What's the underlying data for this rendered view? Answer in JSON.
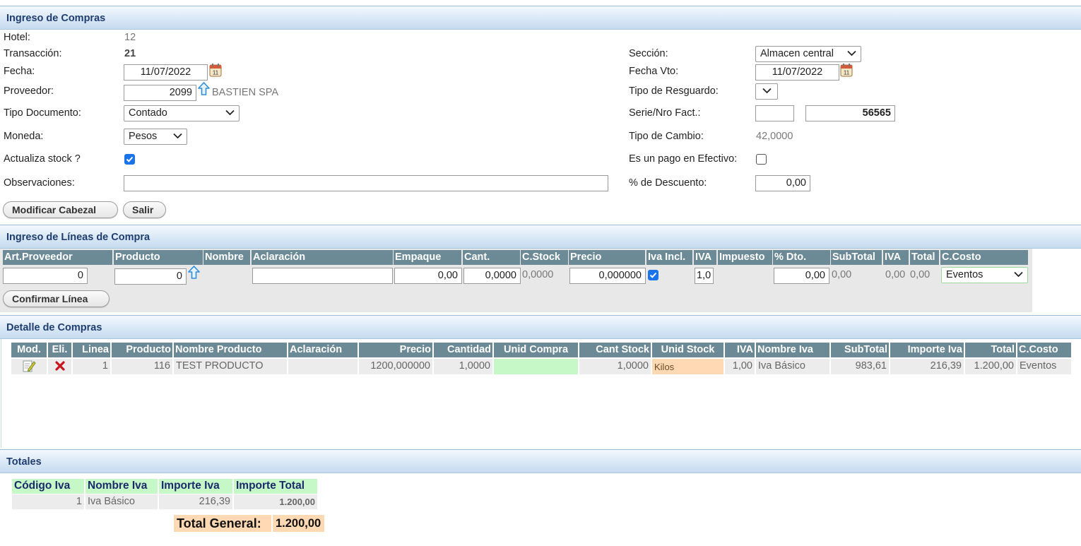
{
  "cabecera": {
    "title": "Ingreso de Compras",
    "hotel_label": "Hotel:",
    "hotel_value": "12",
    "transaccion_label": "Transacción:",
    "transaccion_value": "21",
    "fecha_label": "Fecha:",
    "fecha_value": "11/07/2022",
    "proveedor_label": "Proveedor:",
    "proveedor_code": "2099",
    "proveedor_name": "BASTIEN SPA",
    "tipo_documento_label": "Tipo Documento:",
    "tipo_documento_value": "Contado",
    "moneda_label": "Moneda:",
    "moneda_value": "Pesos",
    "actualiza_stock_label": "Actualiza stock ?",
    "actualiza_stock_checked": true,
    "observaciones_label": "Observaciones:",
    "observaciones_value": "",
    "seccion_label": "Sección:",
    "seccion_value": "Almacen central",
    "fecha_vto_label": "Fecha Vto:",
    "fecha_vto_value": "11/07/2022",
    "tipo_resguardo_label": "Tipo de Resguardo:",
    "tipo_resguardo_value": "",
    "serie_label": "Serie/Nro Fact.:",
    "serie_value": "",
    "nro_fact_value": "56565",
    "tipo_cambio_label": "Tipo de Cambio:",
    "tipo_cambio_value": "42,0000",
    "pago_efectivo_label": "Es un pago en Efectivo:",
    "pago_efectivo_checked": false,
    "descuento_label": "% de Descuento:",
    "descuento_value": "0,00",
    "modificar_button": "Modificar Cabezal",
    "salir_button": "Salir"
  },
  "lineas": {
    "title": "Ingreso de Líneas de Compra",
    "columns": [
      "Art.Proveedor",
      "Producto",
      "Nombre",
      "Aclaración",
      "Empaque",
      "Cant.",
      "C.Stock",
      "Precio",
      "Iva Incl.",
      "IVA",
      "Impuesto",
      "% Dto.",
      "SubTotal",
      "IVA",
      "Total",
      "C.Costo"
    ],
    "art_proveedor": "0",
    "producto": "0",
    "aclaracion": "",
    "empaque": "0,00",
    "cant": "0,0000",
    "cstock": "0,0000",
    "precio": "0,000000",
    "iva_incl_checked": true,
    "iva": "1,0",
    "dto": "0,00",
    "subtotal": "0,00",
    "iva_monto": "0,00",
    "total": "0,00",
    "ccosto": "Eventos",
    "confirmar_button": "Confirmar Línea"
  },
  "detalle": {
    "title": "Detalle de Compras",
    "columns": [
      "Mod.",
      "Eli.",
      "Linea",
      "Producto",
      "Nombre Producto",
      "Aclaración",
      "Precio",
      "Cantidad",
      "Unid Compra",
      "Cant Stock",
      "Unid Stock",
      "IVA",
      "Nombre Iva",
      "SubTotal",
      "Importe Iva",
      "Total",
      "C.Costo"
    ],
    "rows": [
      {
        "linea": "1",
        "producto": "116",
        "nombre": "TEST PRODUCTO",
        "aclaracion": "",
        "precio": "1200,000000",
        "cantidad": "1,0000",
        "unid_compra": "",
        "cant_stock": "1,0000",
        "unid_stock": "Kilos",
        "iva": "1,00",
        "nombre_iva": "Iva Básico",
        "subtotal": "983,61",
        "importe_iva": "216,39",
        "total": "1.200,00",
        "ccosto": "Eventos"
      }
    ]
  },
  "totales": {
    "title": "Totales",
    "columns": [
      "Código Iva",
      "Nombre Iva",
      "Importe Iva",
      "Importe Total"
    ],
    "rows": [
      {
        "codigo": "1",
        "nombre": "Iva Básico",
        "importe_iva": "216,39",
        "importe_total": "1.200,00"
      }
    ],
    "total_general_label": "Total General:",
    "total_general_value": "1.200,00"
  },
  "colors": {
    "header_text": "#1f3d6e",
    "table_header_bg": "#6c8a96",
    "green_cell": "#c6f7c6",
    "orange_cell": "#ffd9b3",
    "checkbox_blue": "#1a73e8"
  }
}
